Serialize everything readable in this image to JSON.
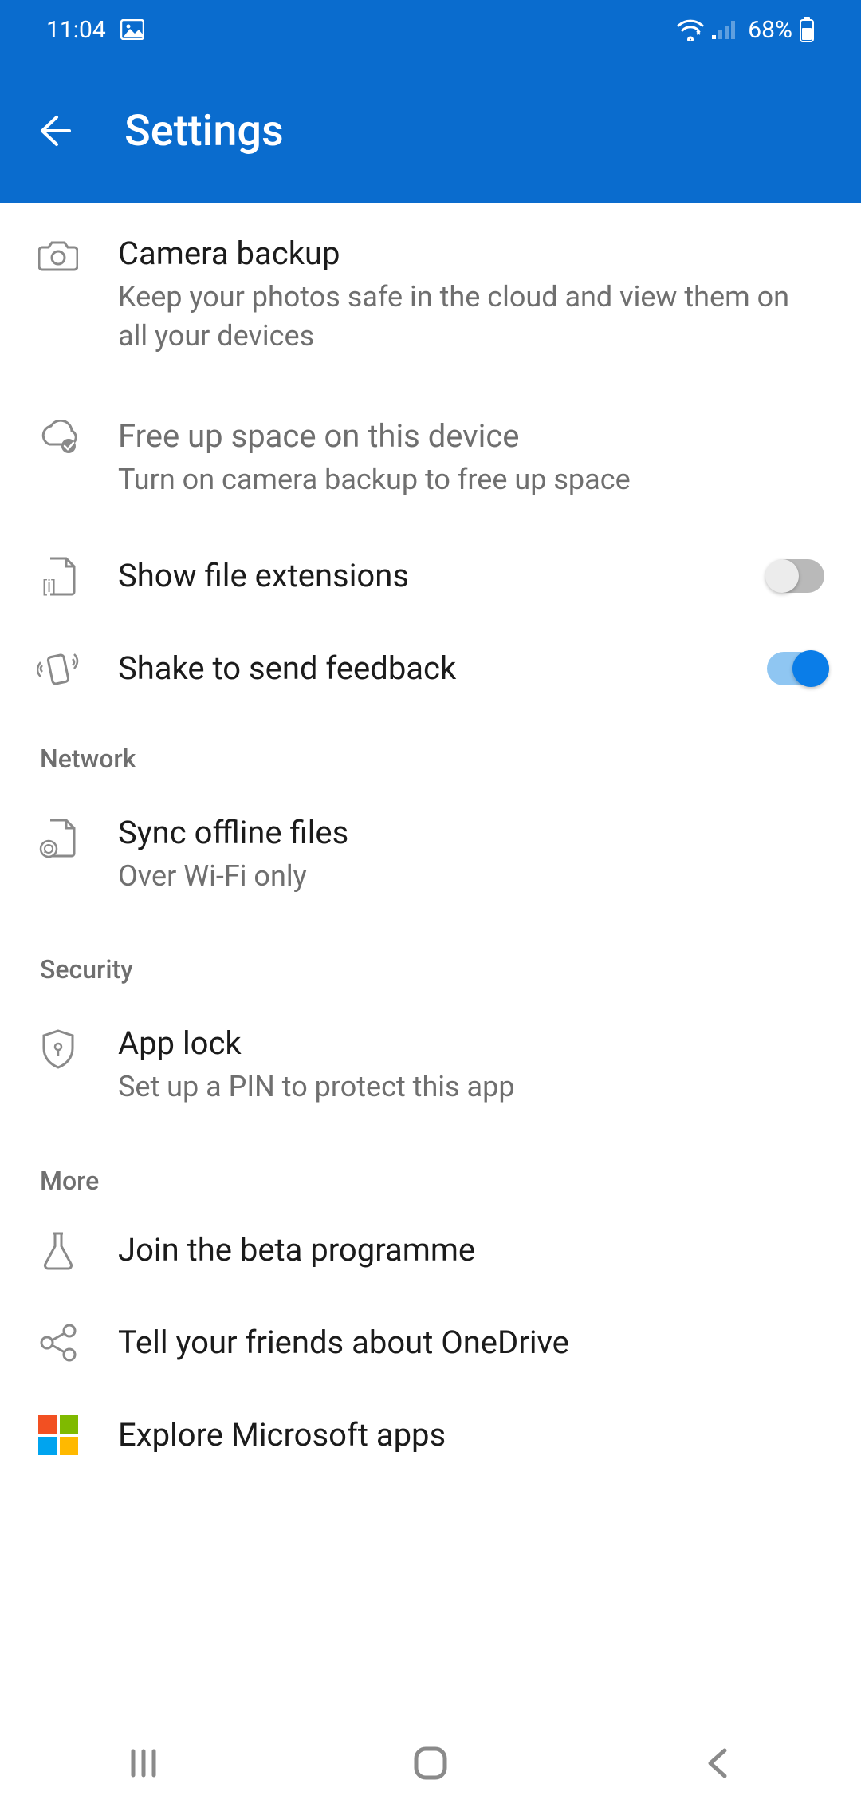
{
  "status": {
    "time": "11:04",
    "battery": "68%"
  },
  "header": {
    "title": "Settings"
  },
  "items": {
    "camera_backup": {
      "title": "Camera backup",
      "sub": "Keep your photos safe in the cloud and view them on all your devices"
    },
    "free_up": {
      "title": "Free up space on this device",
      "sub": "Turn on camera backup to free up space"
    },
    "show_ext": {
      "title": "Show file extensions"
    },
    "shake": {
      "title": "Shake to send feedback"
    },
    "sync_offline": {
      "title": "Sync offline files",
      "sub": "Over Wi-Fi only"
    },
    "app_lock": {
      "title": "App lock",
      "sub": "Set up a PIN to protect this app"
    },
    "beta": {
      "title": "Join the beta programme"
    },
    "tell": {
      "title": "Tell your friends about OneDrive"
    },
    "explore": {
      "title": "Explore Microsoft apps"
    }
  },
  "sections": {
    "network": "Network",
    "security": "Security",
    "more": "More"
  },
  "colors": {
    "primary": "#0a6cce",
    "accent": "#0a7de8"
  }
}
